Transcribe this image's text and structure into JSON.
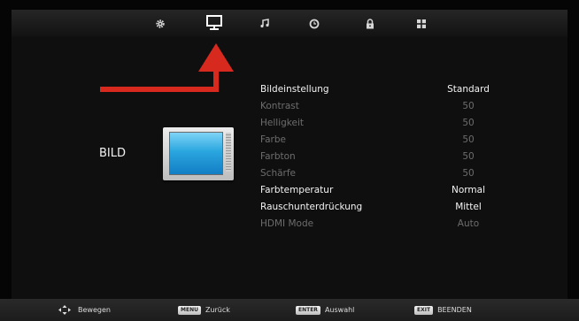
{
  "tabs": [
    {
      "icon": "gear-icon"
    },
    {
      "icon": "monitor-icon",
      "active": true
    },
    {
      "icon": "music-note-icon"
    },
    {
      "icon": "clock-icon"
    },
    {
      "icon": "lock-icon"
    },
    {
      "icon": "grid-icon"
    }
  ],
  "colors": {
    "arrow": "#d8291f",
    "active_tab": "#ffffff",
    "inactive_tab": "#d6d6d6"
  },
  "menu": {
    "title": "BILD",
    "settings": [
      {
        "label": "Bildeinstellung",
        "value": "Standard",
        "enabled": true
      },
      {
        "label": "Kontrast",
        "value": "50",
        "enabled": false
      },
      {
        "label": "Helligkeit",
        "value": "50",
        "enabled": false
      },
      {
        "label": "Farbe",
        "value": "50",
        "enabled": false
      },
      {
        "label": "Farbton",
        "value": "50",
        "enabled": false
      },
      {
        "label": "Schärfe",
        "value": "50",
        "enabled": false
      },
      {
        "label": "Farbtemperatur",
        "value": "Normal",
        "enabled": true
      },
      {
        "label": "Rauschunterdrückung",
        "value": "Mittel",
        "enabled": true
      },
      {
        "label": "HDMI Mode",
        "value": "Auto",
        "enabled": false
      }
    ]
  },
  "footer": {
    "move": {
      "label": "Bewegen"
    },
    "back": {
      "key": "MENU",
      "label": "Zurück"
    },
    "select": {
      "key": "ENTER",
      "label": "Auswahl"
    },
    "exit": {
      "key": "EXIT",
      "label": "BEENDEN"
    }
  }
}
